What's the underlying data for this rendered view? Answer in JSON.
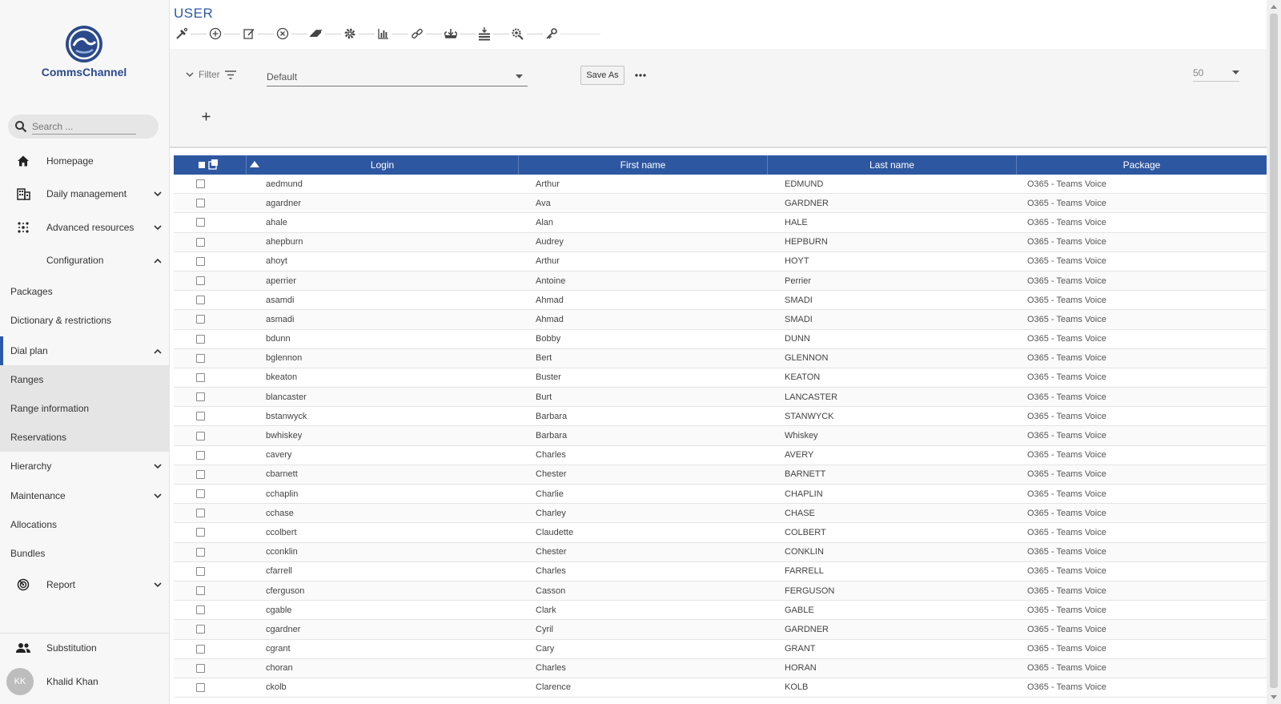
{
  "app": {
    "brand": "CommsChannel"
  },
  "search": {
    "placeholder": "Search ..."
  },
  "sidebar": {
    "main_items": [
      {
        "label": "Homepage",
        "icon": "home-icon"
      },
      {
        "label": "Daily management",
        "icon": "building-icon"
      },
      {
        "label": "Advanced resources",
        "icon": "network-icon"
      },
      {
        "label": "Configuration"
      }
    ],
    "config_items": [
      "Packages",
      "Dictionary & restrictions",
      "Dial plan"
    ],
    "dial_plan_items": [
      "Ranges",
      "Range information",
      "Reservations"
    ],
    "more_items": [
      "Hierarchy",
      "Maintenance",
      "Allocations",
      "Bundles"
    ],
    "report": "Report",
    "substitution": "Substitution",
    "user": {
      "initials": "KK",
      "name": "Khalid Khan"
    }
  },
  "page": {
    "title": "USER"
  },
  "toolbar_icons": [
    "tools-icon",
    "add-circle-icon",
    "edit-icon",
    "delete-circle-icon",
    "eraser-icon",
    "gear-icon",
    "bar-chart-icon",
    "link-icon",
    "import-icon",
    "stack-icon",
    "search-settings-icon",
    "key-icon"
  ],
  "filter": {
    "label": "Filter",
    "preset": "Default",
    "save_as": "Save As",
    "page_size": "50"
  },
  "table": {
    "columns": [
      "Login",
      "First name",
      "Last name",
      "Package"
    ],
    "rows": [
      [
        "aedmund",
        "Arthur",
        "EDMUND",
        "O365 - Teams Voice"
      ],
      [
        "agardner",
        "Ava",
        "GARDNER",
        "O365 - Teams Voice"
      ],
      [
        "ahale",
        "Alan",
        "HALE",
        "O365 - Teams Voice"
      ],
      [
        "ahepburn",
        "Audrey",
        "HEPBURN",
        "O365 - Teams Voice"
      ],
      [
        "ahoyt",
        "Arthur",
        "HOYT",
        "O365 - Teams Voice"
      ],
      [
        "aperrier",
        "Antoine",
        "Perrier",
        "O365 - Teams Voice"
      ],
      [
        "asamdi",
        "Ahmad",
        "SMADI",
        "O365 - Teams Voice"
      ],
      [
        "asmadi",
        "Ahmad",
        "SMADI",
        "O365 - Teams Voice"
      ],
      [
        "bdunn",
        "Bobby",
        "DUNN",
        "O365 - Teams Voice"
      ],
      [
        "bglennon",
        "Bert",
        "GLENNON",
        "O365 - Teams Voice"
      ],
      [
        "bkeaton",
        "Buster",
        "KEATON",
        "O365 - Teams Voice"
      ],
      [
        "blancaster",
        "Burt",
        "LANCASTER",
        "O365 - Teams Voice"
      ],
      [
        "bstanwyck",
        "Barbara",
        "STANWYCK",
        "O365 - Teams Voice"
      ],
      [
        "bwhiskey",
        "Barbara",
        "Whiskey",
        "O365 - Teams Voice"
      ],
      [
        "cavery",
        "Charles",
        "AVERY",
        "O365 - Teams Voice"
      ],
      [
        "cbarnett",
        "Chester",
        "BARNETT",
        "O365 - Teams Voice"
      ],
      [
        "cchaplin",
        "Charlie",
        "CHAPLIN",
        "O365 - Teams Voice"
      ],
      [
        "cchase",
        "Charley",
        "CHASE",
        "O365 - Teams Voice"
      ],
      [
        "ccolbert",
        "Claudette",
        "COLBERT",
        "O365 - Teams Voice"
      ],
      [
        "cconklin",
        "Chester",
        "CONKLIN",
        "O365 - Teams Voice"
      ],
      [
        "cfarrell",
        "Charles",
        "FARRELL",
        "O365 - Teams Voice"
      ],
      [
        "cferguson",
        "Casson",
        "FERGUSON",
        "O365 - Teams Voice"
      ],
      [
        "cgable",
        "Clark",
        "GABLE",
        "O365 - Teams Voice"
      ],
      [
        "cgardner",
        "Cyril",
        "GARDNER",
        "O365 - Teams Voice"
      ],
      [
        "cgrant",
        "Cary",
        "GRANT",
        "O365 - Teams Voice"
      ],
      [
        "choran",
        "Charles",
        "HORAN",
        "O365 - Teams Voice"
      ],
      [
        "ckolb",
        "Clarence",
        "KOLB",
        "O365 - Teams Voice"
      ]
    ]
  },
  "colors": {
    "accent": "#2e57a1",
    "title": "#2b5aa8",
    "sidebar_bg": "#f7f7f7"
  }
}
